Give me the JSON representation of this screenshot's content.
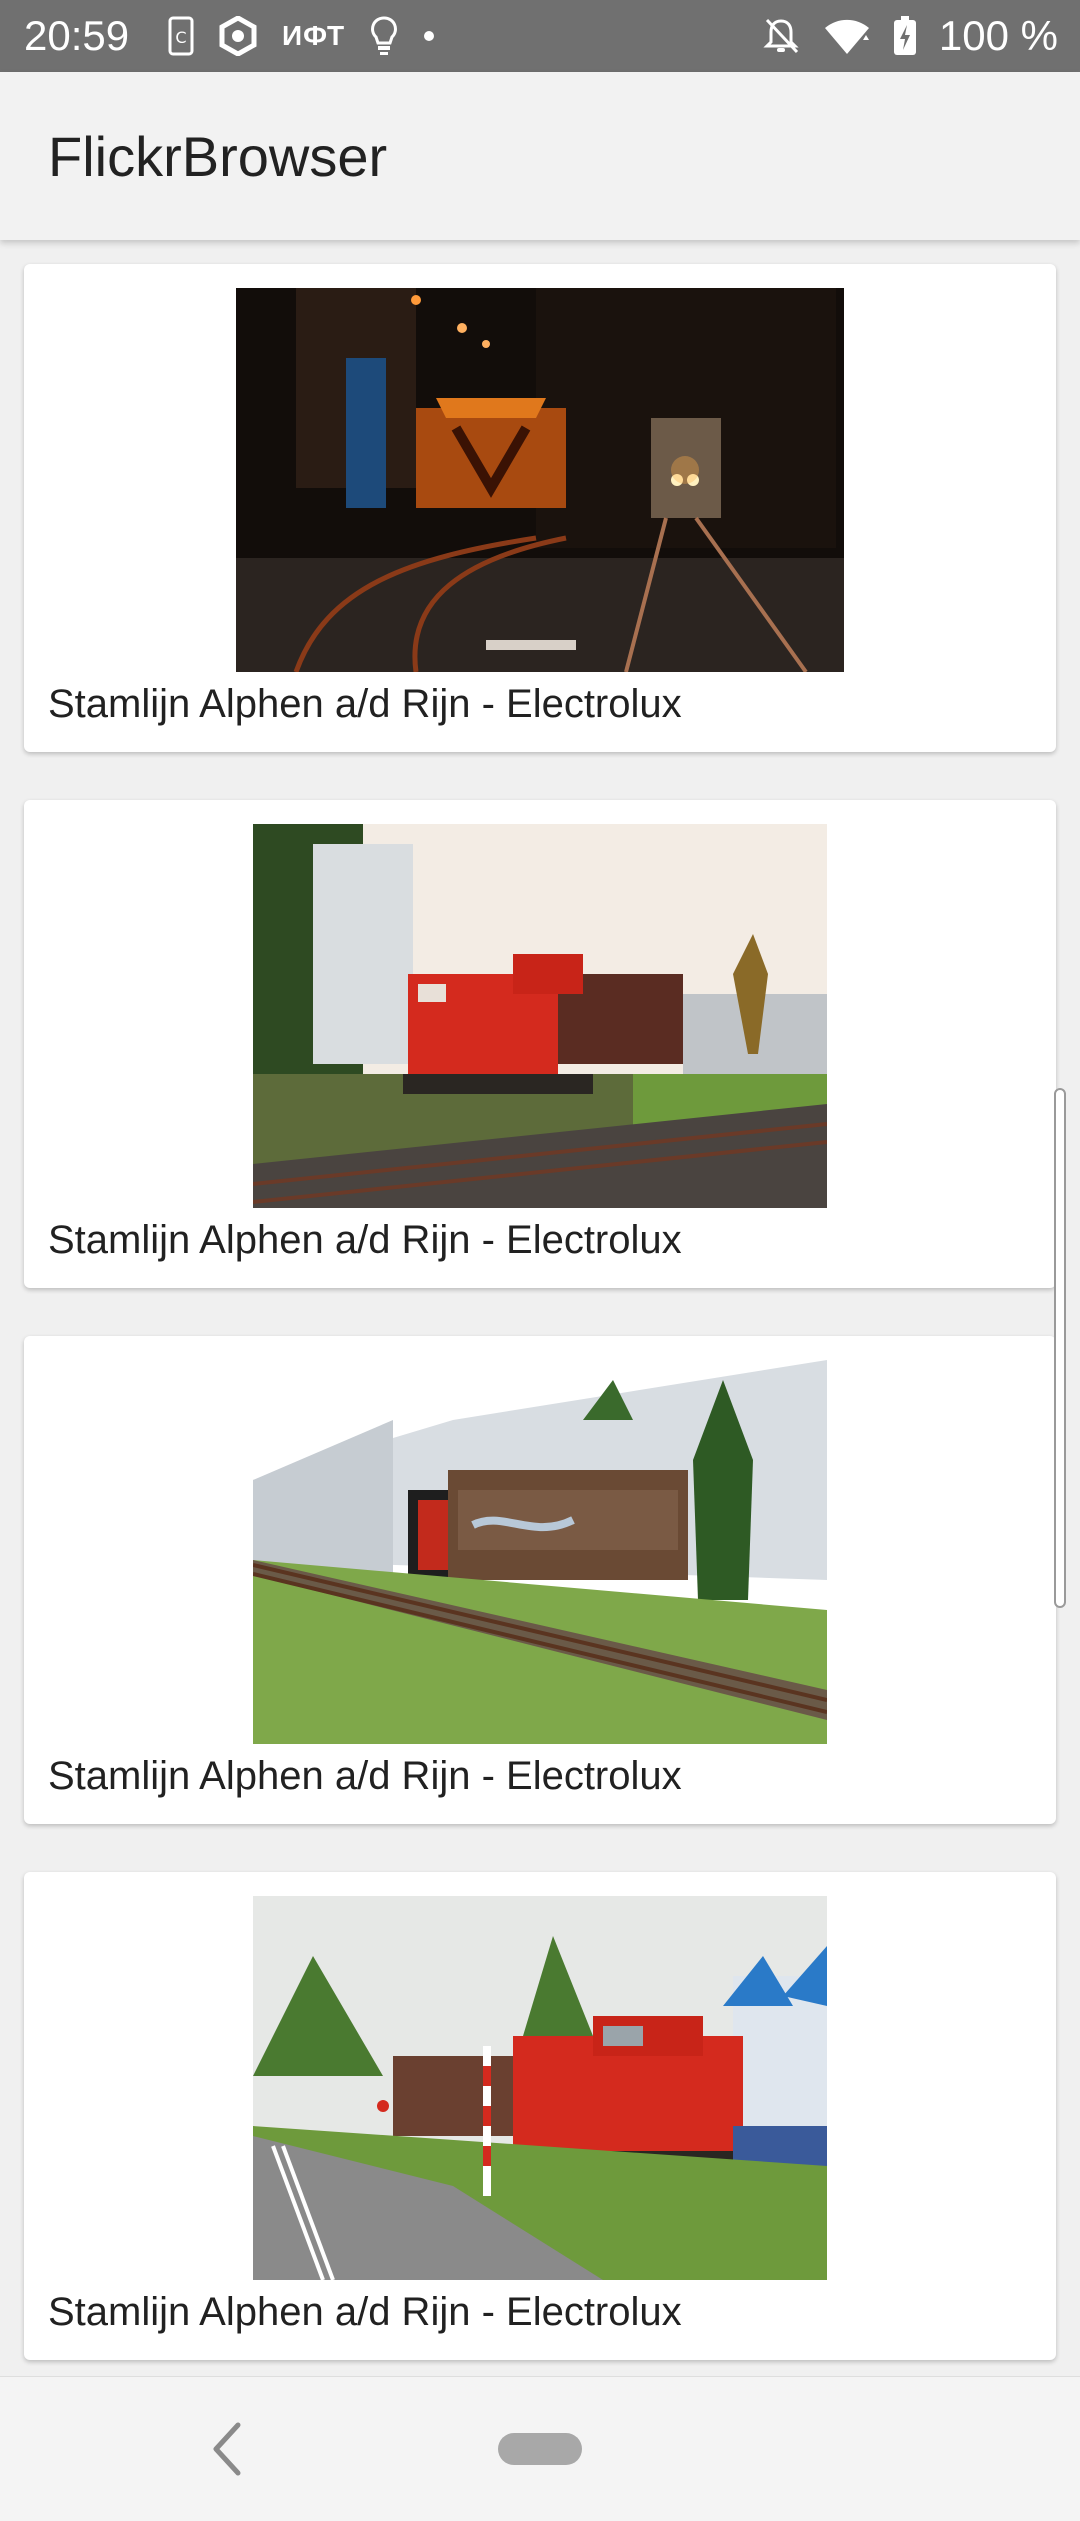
{
  "status_bar": {
    "time": "20:59",
    "left_icons": [
      "sim-card-icon",
      "hexagon-app-icon",
      "lightbulb-icon",
      "dot-icon"
    ],
    "left_text": "ИФТ",
    "right_icons": [
      "mute-bell-icon",
      "wifi-icon",
      "battery-charging-icon"
    ],
    "battery": "100 %"
  },
  "app_bar": {
    "title": "FlickrBrowser"
  },
  "feed": {
    "items": [
      {
        "caption": "Stamlijn Alphen a/d Rijn - Electrolux",
        "photo": "night-train-tunnel"
      },
      {
        "caption": "Stamlijn Alphen a/d Rijn - Electrolux",
        "photo": "red-locomotive-freight"
      },
      {
        "caption": "Stamlijn Alphen a/d Rijn - Electrolux",
        "photo": "freight-wagons-building"
      },
      {
        "caption": "Stamlijn Alphen a/d Rijn - Electrolux",
        "photo": "locomotive-road-crossing"
      }
    ]
  },
  "nav_bar": {
    "icons": [
      "back-icon",
      "home-pill-icon"
    ]
  },
  "colors": {
    "status_bar": "#707070",
    "app_bar": "#f2f2f2",
    "background": "#f0f0f0",
    "card": "#ffffff",
    "locomotive_red": "#d42a1e"
  }
}
